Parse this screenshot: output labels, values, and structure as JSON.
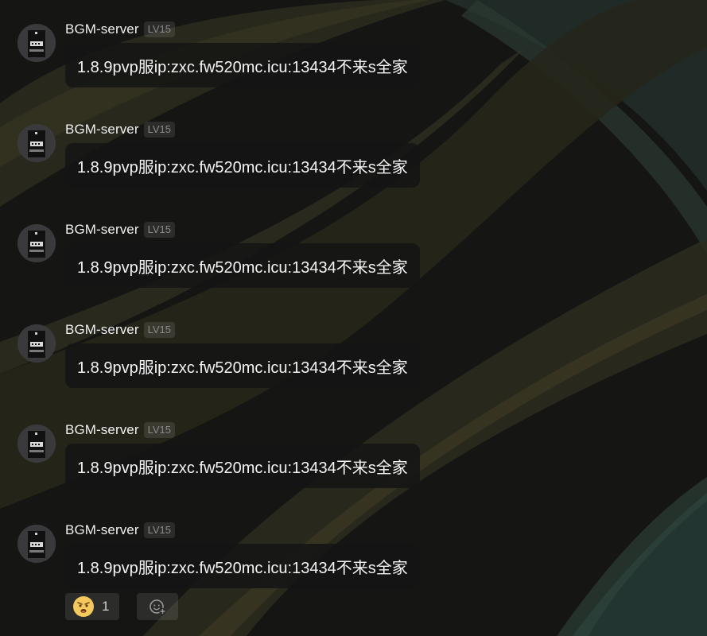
{
  "messages": [
    {
      "sender": "BGM-server",
      "level": "LV15",
      "text": "1.8.9pvp服ip:zxc.fw520mc.icu:13434不来s全家"
    },
    {
      "sender": "BGM-server",
      "level": "LV15",
      "text": "1.8.9pvp服ip:zxc.fw520mc.icu:13434不来s全家"
    },
    {
      "sender": "BGM-server",
      "level": "LV15",
      "text": "1.8.9pvp服ip:zxc.fw520mc.icu:13434不来s全家"
    },
    {
      "sender": "BGM-server",
      "level": "LV15",
      "text": "1.8.9pvp服ip:zxc.fw520mc.icu:13434不来s全家"
    },
    {
      "sender": "BGM-server",
      "level": "LV15",
      "text": "1.8.9pvp服ip:zxc.fw520mc.icu:13434不来s全家"
    },
    {
      "sender": "BGM-server",
      "level": "LV15",
      "text": "1.8.9pvp服ip:zxc.fw520mc.icu:13434不来s全家"
    }
  ],
  "reactions": {
    "emoji_icon": "angry-face-icon",
    "count": "1",
    "add_icon": "add-reaction-icon"
  },
  "colors": {
    "background": "#141412",
    "bubble": "#151515",
    "level_badge_text": "#8a8a8a"
  }
}
